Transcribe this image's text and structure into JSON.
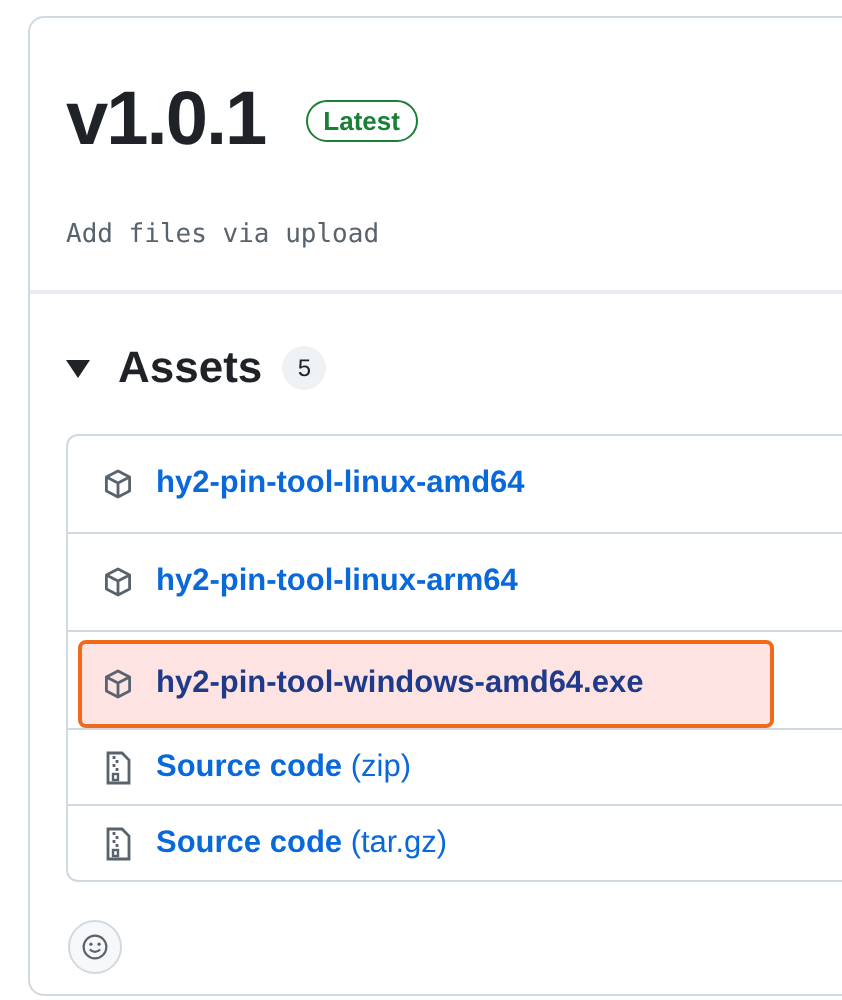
{
  "release": {
    "tag": "v1.0.1",
    "badge": "Latest",
    "message": "Add files via upload"
  },
  "assets": {
    "title": "Assets",
    "count": "5",
    "expanded": true,
    "items": [
      {
        "kind": "package",
        "name": "hy2-pin-tool-linux-amd64",
        "highlighted": false
      },
      {
        "kind": "package",
        "name": "hy2-pin-tool-linux-arm64",
        "highlighted": false
      },
      {
        "kind": "package",
        "name": "hy2-pin-tool-windows-amd64.exe",
        "highlighted": true
      },
      {
        "kind": "source",
        "name": "Source code",
        "suffix": "(zip)",
        "highlighted": false
      },
      {
        "kind": "source",
        "name": "Source code",
        "suffix": "(tar.gz)",
        "highlighted": false
      }
    ]
  }
}
